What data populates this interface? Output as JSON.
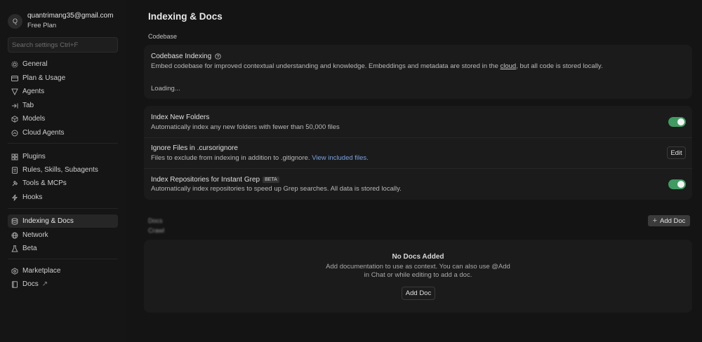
{
  "account": {
    "avatar_letter": "Q",
    "email": "quantrimang35@gmail.com",
    "plan": "Free Plan"
  },
  "search": {
    "placeholder": "Search settings Ctrl+F"
  },
  "sidebar": {
    "group1": [
      {
        "label": "General",
        "icon": "gear-icon"
      },
      {
        "label": "Plan & Usage",
        "icon": "credit-card-icon"
      },
      {
        "label": "Agents",
        "icon": "agents-icon"
      },
      {
        "label": "Tab",
        "icon": "tab-arrow-icon"
      },
      {
        "label": "Models",
        "icon": "cube-icon"
      },
      {
        "label": "Cloud Agents",
        "icon": "cloud-icon"
      }
    ],
    "group2": [
      {
        "label": "Plugins",
        "icon": "plugins-icon"
      },
      {
        "label": "Rules, Skills, Subagents",
        "icon": "document-icon"
      },
      {
        "label": "Tools & MCPs",
        "icon": "tools-icon"
      },
      {
        "label": "Hooks",
        "icon": "bolt-icon"
      }
    ],
    "group3": [
      {
        "label": "Indexing & Docs",
        "icon": "database-icon",
        "active": true
      },
      {
        "label": "Network",
        "icon": "globe-icon"
      },
      {
        "label": "Beta",
        "icon": "flask-icon"
      }
    ],
    "group4": [
      {
        "label": "Marketplace",
        "icon": "marketplace-icon"
      },
      {
        "label": "Docs",
        "icon": "book-icon",
        "external_icon": "↗"
      }
    ]
  },
  "main": {
    "title": "Indexing & Docs",
    "codebase_label": "Codebase",
    "codebase_indexing": {
      "title": "Codebase Indexing",
      "desc_before": "Embed codebase for improved contextual understanding and knowledge. Embeddings and metadata are stored in the ",
      "desc_link": "cloud",
      "desc_after": ", but all code is stored locally.",
      "status": "Loading..."
    },
    "settings": [
      {
        "title": "Index New Folders",
        "desc": "Automatically index any new folders with fewer than 50,000 files",
        "control": "toggle",
        "enabled": true
      },
      {
        "title": "Ignore Files in .cursorignore",
        "desc": "Files to exclude from indexing in addition to .gitignore. ",
        "link": "View included files.",
        "control": "button",
        "button_label": "Edit"
      },
      {
        "title": "Index Repositories for Instant Grep",
        "badge": "BETA",
        "desc": "Automatically index repositories to speed up Grep searches. All data is stored locally.",
        "control": "toggle",
        "enabled": true
      }
    ],
    "docs": {
      "label_blurred_1": "Docs",
      "label_blurred_2": "Crawl",
      "add_button": "Add Doc",
      "empty_title": "No Docs Added",
      "empty_desc_1": "Add documentation to use as context. You can also use @Add",
      "empty_desc_2": "in Chat or while editing to add a doc.",
      "empty_button": "Add Doc"
    }
  },
  "colors": {
    "background": "#141414",
    "card": "#1b1b1b",
    "toggle_on": "#3f9b62",
    "link": "#7aa2e0"
  }
}
